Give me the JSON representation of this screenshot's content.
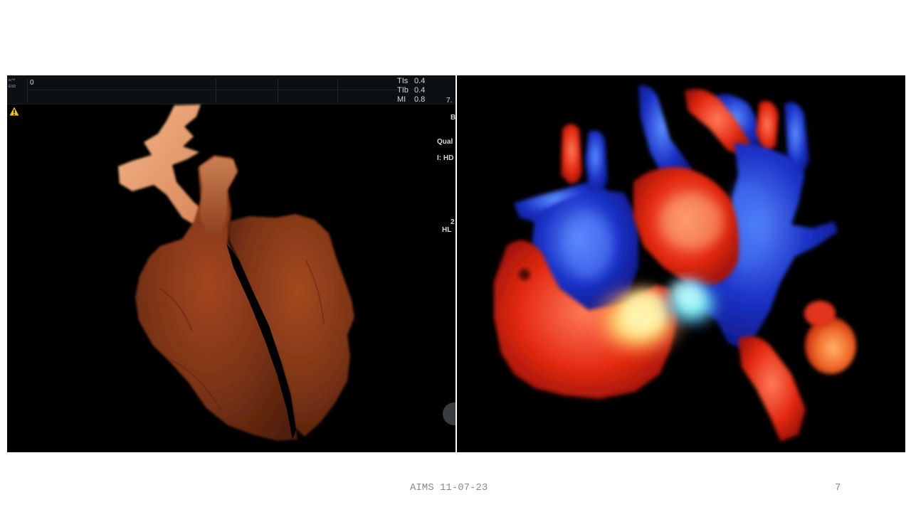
{
  "footer": {
    "text": "AIMS 11-07-23",
    "slide_number": "7"
  },
  "ultrasound": {
    "top_left_line1": "iu⁺ᴹ",
    "top_left_line2": "ESD",
    "depth_value": "0",
    "tis_label": "TIs",
    "tis_value": "0.4",
    "tib_label": "TIb",
    "tib_value": "0.4",
    "mi_label": "MI",
    "mi_value": "0.8",
    "edge_value": "7.",
    "edge_b": "B",
    "qual_label": "Qual",
    "hd_label": "I: HD",
    "edge_2": "2",
    "hl_label": "HL"
  },
  "colors": {
    "tissue_brown": "#7a3316",
    "tissue_orange": "#e39a6a",
    "flow_red": "#e42a12",
    "flow_blue": "#1b32c8",
    "flow_yellow": "#fff2a0",
    "flow_cyan": "#6fe3ee"
  }
}
